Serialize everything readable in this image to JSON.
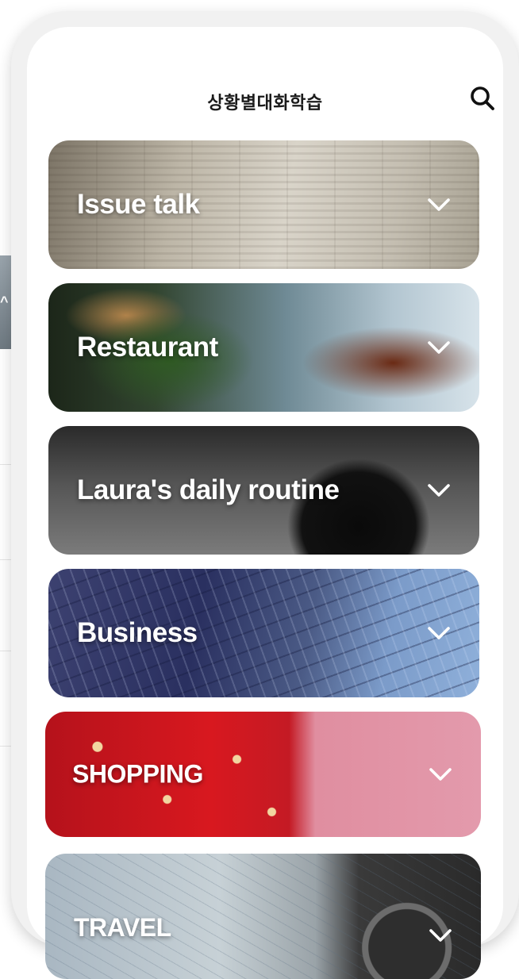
{
  "header": {
    "title": "상황별대화학습"
  },
  "categories": [
    {
      "label": "Issue talk"
    },
    {
      "label": "Restaurant"
    },
    {
      "label": "Laura's daily routine"
    },
    {
      "label": "Business"
    },
    {
      "label": "SHOPPING"
    },
    {
      "label": "TRAVEL"
    }
  ],
  "icons": {
    "search": "search-icon",
    "expand": "chevron-down-icon"
  },
  "colors": {
    "title_text": "#1b1b1b",
    "card_text": "#ffffff",
    "phone_frame": "#f1f1f1"
  }
}
